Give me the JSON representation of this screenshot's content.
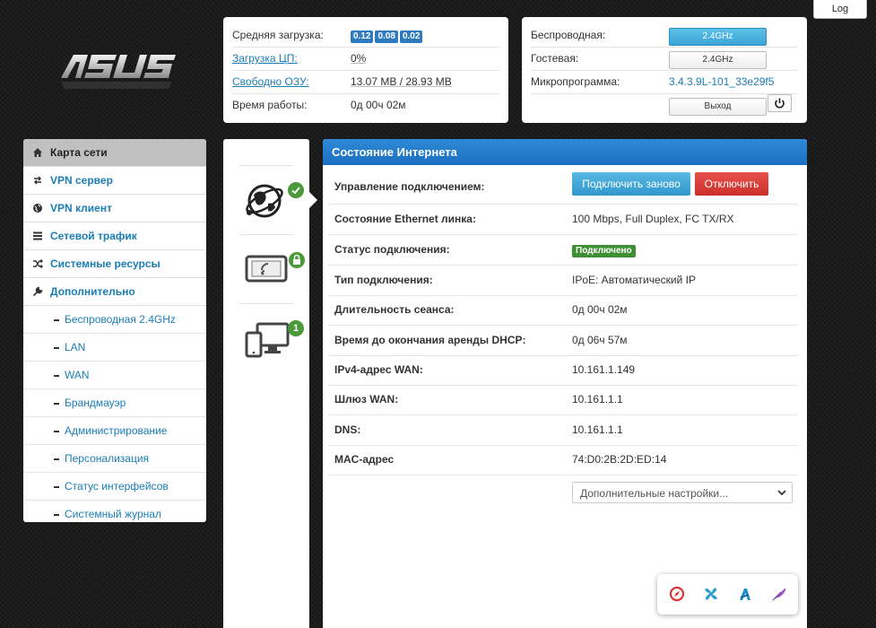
{
  "header": {
    "log_button": "Log",
    "logo_text": "ASUS"
  },
  "info": {
    "load_label": "Средняя загрузка:",
    "load_values": [
      "0.12",
      "0.08",
      "0.02"
    ],
    "cpu_label": "Загрузка ЦП:",
    "cpu_value": "0%",
    "ram_label": "Свободно ОЗУ:",
    "ram_value": "13.07 MB / 28.93 MB",
    "uptime_label": "Время работы:",
    "uptime_value": "0д 00ч 02м"
  },
  "wifi": {
    "wireless_label": "Беспроводная:",
    "wireless_button": "2.4GHz",
    "guest_label": "Гостевая:",
    "guest_button": "2.4GHz",
    "firmware_label": "Микропрограмма:",
    "firmware_value": "3.4.3.9L-101_33e29f5",
    "logout_button": "Выход"
  },
  "sidebar": {
    "items": [
      {
        "label": "Карта сети",
        "icon": "home-icon"
      },
      {
        "label": "VPN сервер",
        "icon": "vpn-server-icon"
      },
      {
        "label": "VPN клиент",
        "icon": "globe-icon"
      },
      {
        "label": "Сетевой трафик",
        "icon": "list-icon"
      },
      {
        "label": "Системные ресурсы",
        "icon": "shuffle-icon"
      },
      {
        "label": "Дополнительно",
        "icon": "wrench-icon"
      }
    ],
    "subitems": [
      "Беспроводная 2.4GHz",
      "LAN",
      "WAN",
      "Брандмауэр",
      "Администрирование",
      "Персонализация",
      "Статус интерфейсов",
      "Системный журнал"
    ]
  },
  "map": {
    "clients_count": "1"
  },
  "main": {
    "title": "Состояние Интернета",
    "control_label": "Управление подключением:",
    "reconnect_button": "Подключить заново",
    "disconnect_button": "Отключить",
    "rows": [
      {
        "label": "Состояние Ethernet линка:",
        "value": "100 Mbps, Full Duplex, FC TX/RX"
      },
      {
        "label": "Статус подключения:",
        "value": "Подключено"
      },
      {
        "label": "Тип подключения:",
        "value": "IPoE: Автоматический IP"
      },
      {
        "label": "Длительность сеанса:",
        "value": "0д 00ч 02м"
      },
      {
        "label": "Время до окончания аренды DHCP:",
        "value": "0д 06ч 57м"
      },
      {
        "label": "IPv4-адрес WAN:",
        "value": "10.161.1.149"
      },
      {
        "label": "Шлюз WAN:",
        "value": "10.161.1.1"
      },
      {
        "label": "DNS:",
        "value": "10.161.1.1"
      },
      {
        "label": "MAC-адрес",
        "value": "74:D0:2B:2D:ED:14"
      }
    ],
    "more_settings": "Дополнительные настройки..."
  },
  "colors": {
    "accent_blue": "#1c6fc0",
    "link_blue": "#1a7db6",
    "status_green": "#3f8f35",
    "danger_red": "#cc2f2a"
  }
}
